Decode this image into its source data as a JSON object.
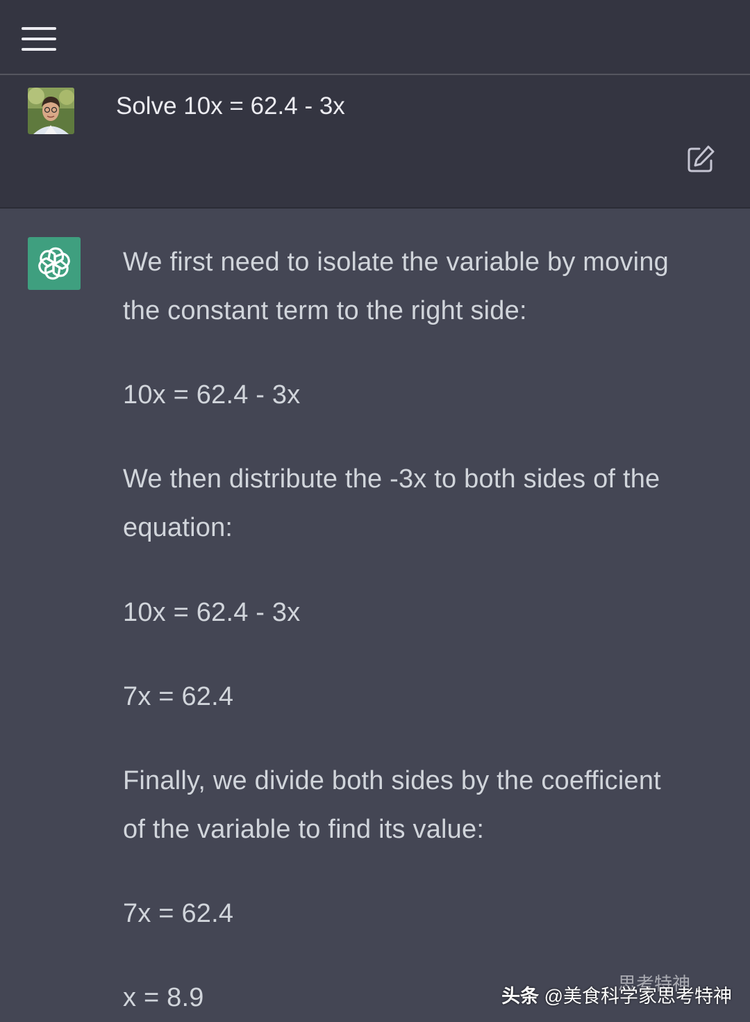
{
  "header": {
    "menu_icon": "hamburger-menu-icon"
  },
  "user_message": {
    "avatar": "user-avatar-photo",
    "text": "Solve 10x = 62.4 - 3x",
    "edit_icon": "edit-icon"
  },
  "assistant_message": {
    "logo_icon": "openai-logo-icon",
    "lines": [
      "We first need to isolate the variable by moving",
      "the constant term to the right side:",
      "10x = 62.4 - 3x",
      "We then distribute the -3x to both sides of the",
      "equation:",
      "10x = 62.4 - 3x",
      "7x = 62.4",
      "Finally, we divide both sides by the coefficient",
      "of the variable to find its value:",
      "7x = 62.4",
      "x = 8.9"
    ]
  },
  "watermark": {
    "brand": "头条",
    "handle": "@美食科学家思考特神",
    "overlay": "思考特神"
  },
  "colors": {
    "topbar_bg": "#343541",
    "assistant_bg": "#444654",
    "gpt_green": "#3f9f7f",
    "text_primary": "#ececf1",
    "text_assistant": "#d1d5db"
  }
}
